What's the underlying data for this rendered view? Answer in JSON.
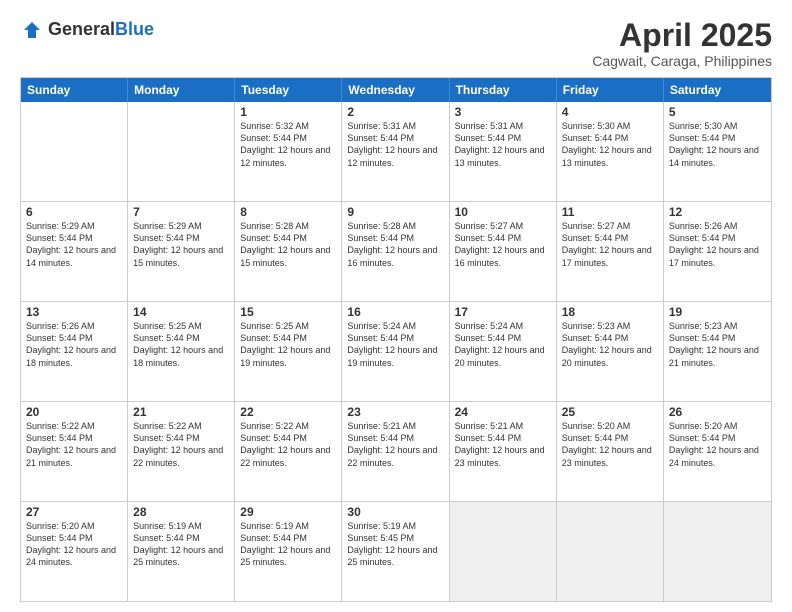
{
  "header": {
    "logo_general": "General",
    "logo_blue": "Blue",
    "month_year": "April 2025",
    "location": "Cagwait, Caraga, Philippines"
  },
  "days_of_week": [
    "Sunday",
    "Monday",
    "Tuesday",
    "Wednesday",
    "Thursday",
    "Friday",
    "Saturday"
  ],
  "weeks": [
    [
      {
        "day": "",
        "sunrise": "",
        "sunset": "",
        "daylight": "",
        "empty": true
      },
      {
        "day": "",
        "sunrise": "",
        "sunset": "",
        "daylight": "",
        "empty": true
      },
      {
        "day": "1",
        "sunrise": "Sunrise: 5:32 AM",
        "sunset": "Sunset: 5:44 PM",
        "daylight": "Daylight: 12 hours and 12 minutes."
      },
      {
        "day": "2",
        "sunrise": "Sunrise: 5:31 AM",
        "sunset": "Sunset: 5:44 PM",
        "daylight": "Daylight: 12 hours and 12 minutes."
      },
      {
        "day": "3",
        "sunrise": "Sunrise: 5:31 AM",
        "sunset": "Sunset: 5:44 PM",
        "daylight": "Daylight: 12 hours and 13 minutes."
      },
      {
        "day": "4",
        "sunrise": "Sunrise: 5:30 AM",
        "sunset": "Sunset: 5:44 PM",
        "daylight": "Daylight: 12 hours and 13 minutes."
      },
      {
        "day": "5",
        "sunrise": "Sunrise: 5:30 AM",
        "sunset": "Sunset: 5:44 PM",
        "daylight": "Daylight: 12 hours and 14 minutes."
      }
    ],
    [
      {
        "day": "6",
        "sunrise": "Sunrise: 5:29 AM",
        "sunset": "Sunset: 5:44 PM",
        "daylight": "Daylight: 12 hours and 14 minutes."
      },
      {
        "day": "7",
        "sunrise": "Sunrise: 5:29 AM",
        "sunset": "Sunset: 5:44 PM",
        "daylight": "Daylight: 12 hours and 15 minutes."
      },
      {
        "day": "8",
        "sunrise": "Sunrise: 5:28 AM",
        "sunset": "Sunset: 5:44 PM",
        "daylight": "Daylight: 12 hours and 15 minutes."
      },
      {
        "day": "9",
        "sunrise": "Sunrise: 5:28 AM",
        "sunset": "Sunset: 5:44 PM",
        "daylight": "Daylight: 12 hours and 16 minutes."
      },
      {
        "day": "10",
        "sunrise": "Sunrise: 5:27 AM",
        "sunset": "Sunset: 5:44 PM",
        "daylight": "Daylight: 12 hours and 16 minutes."
      },
      {
        "day": "11",
        "sunrise": "Sunrise: 5:27 AM",
        "sunset": "Sunset: 5:44 PM",
        "daylight": "Daylight: 12 hours and 17 minutes."
      },
      {
        "day": "12",
        "sunrise": "Sunrise: 5:26 AM",
        "sunset": "Sunset: 5:44 PM",
        "daylight": "Daylight: 12 hours and 17 minutes."
      }
    ],
    [
      {
        "day": "13",
        "sunrise": "Sunrise: 5:26 AM",
        "sunset": "Sunset: 5:44 PM",
        "daylight": "Daylight: 12 hours and 18 minutes."
      },
      {
        "day": "14",
        "sunrise": "Sunrise: 5:25 AM",
        "sunset": "Sunset: 5:44 PM",
        "daylight": "Daylight: 12 hours and 18 minutes."
      },
      {
        "day": "15",
        "sunrise": "Sunrise: 5:25 AM",
        "sunset": "Sunset: 5:44 PM",
        "daylight": "Daylight: 12 hours and 19 minutes."
      },
      {
        "day": "16",
        "sunrise": "Sunrise: 5:24 AM",
        "sunset": "Sunset: 5:44 PM",
        "daylight": "Daylight: 12 hours and 19 minutes."
      },
      {
        "day": "17",
        "sunrise": "Sunrise: 5:24 AM",
        "sunset": "Sunset: 5:44 PM",
        "daylight": "Daylight: 12 hours and 20 minutes."
      },
      {
        "day": "18",
        "sunrise": "Sunrise: 5:23 AM",
        "sunset": "Sunset: 5:44 PM",
        "daylight": "Daylight: 12 hours and 20 minutes."
      },
      {
        "day": "19",
        "sunrise": "Sunrise: 5:23 AM",
        "sunset": "Sunset: 5:44 PM",
        "daylight": "Daylight: 12 hours and 21 minutes."
      }
    ],
    [
      {
        "day": "20",
        "sunrise": "Sunrise: 5:22 AM",
        "sunset": "Sunset: 5:44 PM",
        "daylight": "Daylight: 12 hours and 21 minutes."
      },
      {
        "day": "21",
        "sunrise": "Sunrise: 5:22 AM",
        "sunset": "Sunset: 5:44 PM",
        "daylight": "Daylight: 12 hours and 22 minutes."
      },
      {
        "day": "22",
        "sunrise": "Sunrise: 5:22 AM",
        "sunset": "Sunset: 5:44 PM",
        "daylight": "Daylight: 12 hours and 22 minutes."
      },
      {
        "day": "23",
        "sunrise": "Sunrise: 5:21 AM",
        "sunset": "Sunset: 5:44 PM",
        "daylight": "Daylight: 12 hours and 22 minutes."
      },
      {
        "day": "24",
        "sunrise": "Sunrise: 5:21 AM",
        "sunset": "Sunset: 5:44 PM",
        "daylight": "Daylight: 12 hours and 23 minutes."
      },
      {
        "day": "25",
        "sunrise": "Sunrise: 5:20 AM",
        "sunset": "Sunset: 5:44 PM",
        "daylight": "Daylight: 12 hours and 23 minutes."
      },
      {
        "day": "26",
        "sunrise": "Sunrise: 5:20 AM",
        "sunset": "Sunset: 5:44 PM",
        "daylight": "Daylight: 12 hours and 24 minutes."
      }
    ],
    [
      {
        "day": "27",
        "sunrise": "Sunrise: 5:20 AM",
        "sunset": "Sunset: 5:44 PM",
        "daylight": "Daylight: 12 hours and 24 minutes."
      },
      {
        "day": "28",
        "sunrise": "Sunrise: 5:19 AM",
        "sunset": "Sunset: 5:44 PM",
        "daylight": "Daylight: 12 hours and 25 minutes."
      },
      {
        "day": "29",
        "sunrise": "Sunrise: 5:19 AM",
        "sunset": "Sunset: 5:44 PM",
        "daylight": "Daylight: 12 hours and 25 minutes."
      },
      {
        "day": "30",
        "sunrise": "Sunrise: 5:19 AM",
        "sunset": "Sunset: 5:45 PM",
        "daylight": "Daylight: 12 hours and 25 minutes."
      },
      {
        "day": "",
        "sunrise": "",
        "sunset": "",
        "daylight": "",
        "empty": true,
        "shaded": true
      },
      {
        "day": "",
        "sunrise": "",
        "sunset": "",
        "daylight": "",
        "empty": true,
        "shaded": true
      },
      {
        "day": "",
        "sunrise": "",
        "sunset": "",
        "daylight": "",
        "empty": true,
        "shaded": true
      }
    ]
  ]
}
